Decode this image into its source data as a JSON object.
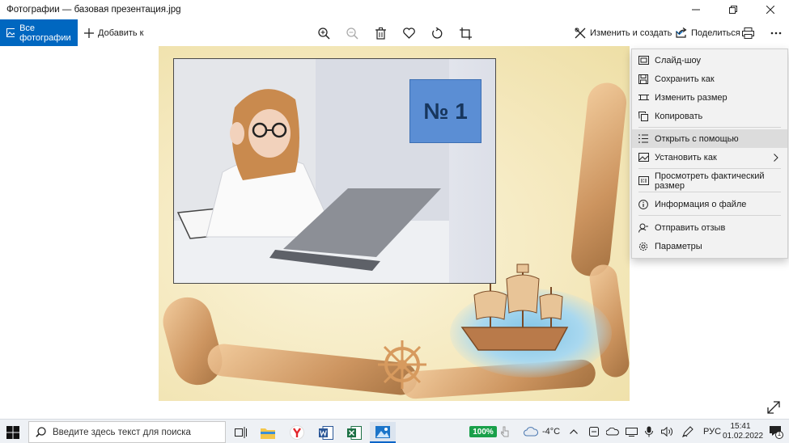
{
  "window": {
    "title": "Фотографии — базовая презентация.jpg"
  },
  "toolbar": {
    "all_photos": "Все фотографии",
    "add_to": "Добавить к",
    "edit_create": "Изменить и создать",
    "share": "Поделиться"
  },
  "slide": {
    "badge_text": "№ 1"
  },
  "menu": {
    "items": [
      {
        "label": "Слайд-шоу",
        "icon": "slideshow-icon"
      },
      {
        "label": "Сохранить как",
        "icon": "save-icon"
      },
      {
        "label": "Изменить размер",
        "icon": "resize-icon"
      },
      {
        "label": "Копировать",
        "icon": "copy-icon"
      },
      {
        "label": "Открыть с помощью",
        "icon": "open-with-icon"
      },
      {
        "label": "Установить как",
        "icon": "set-as-icon"
      },
      {
        "label": "Просмотреть фактический размер",
        "icon": "actual-size-icon"
      },
      {
        "label": "Информация о файле",
        "icon": "info-icon"
      },
      {
        "label": "Отправить отзыв",
        "icon": "feedback-icon"
      },
      {
        "label": "Параметры",
        "icon": "settings-icon"
      }
    ]
  },
  "taskbar": {
    "search_placeholder": "Введите здесь текст для поиска",
    "battery": "100%",
    "weather": "-4°C",
    "language": "РУС",
    "time": "15:41",
    "date": "01.02.2022",
    "notification_count": "1"
  },
  "colors": {
    "accent": "#0067c0",
    "badge": "#5b8ed4",
    "battery": "#19a04a"
  }
}
